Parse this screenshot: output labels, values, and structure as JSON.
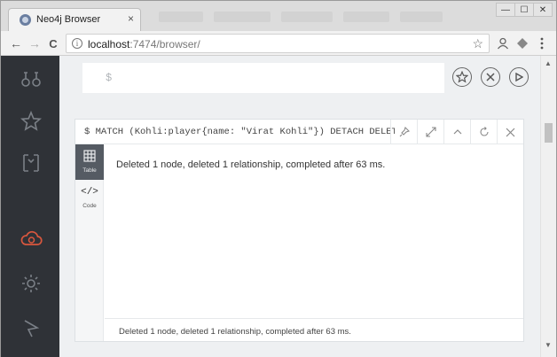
{
  "browser": {
    "tab_title": "Neo4j Browser",
    "tab_close": "×",
    "url_host": "localhost",
    "url_rest": ":7474/browser/",
    "info_icon": "i",
    "window_controls": [
      "—",
      "☐",
      "✕"
    ],
    "nav": {
      "back": "←",
      "forward": "→",
      "reload": "C"
    }
  },
  "editor": {
    "prompt": "$"
  },
  "editor_actions": {
    "favorite_icon": "star-icon",
    "clear_icon": "close-icon",
    "run_icon": "play-icon"
  },
  "sidebar": {
    "items": [
      {
        "icon": "database-icon"
      },
      {
        "icon": "star-icon"
      },
      {
        "icon": "documents-icon"
      },
      {
        "icon": "cloud-sync-icon",
        "active": true
      },
      {
        "icon": "gear-icon"
      },
      {
        "icon": "about-icon"
      }
    ],
    "accent_color": "#d9573e"
  },
  "frame": {
    "command": "$ MATCH (Kohli:player{name: \"Virat Kohli\"}) DETACH DELETE Kohli",
    "tools": [
      "pin-icon",
      "expand-icon",
      "collapse-icon",
      "rerun-icon",
      "close-icon"
    ],
    "tabs": [
      {
        "label": "Table",
        "active": true
      },
      {
        "label": "Code",
        "active": false
      }
    ],
    "message": "Deleted 1 node, deleted 1 relationship, completed after 63 ms.",
    "footer": "Deleted 1 node, deleted 1 relationship, completed after 63 ms."
  }
}
